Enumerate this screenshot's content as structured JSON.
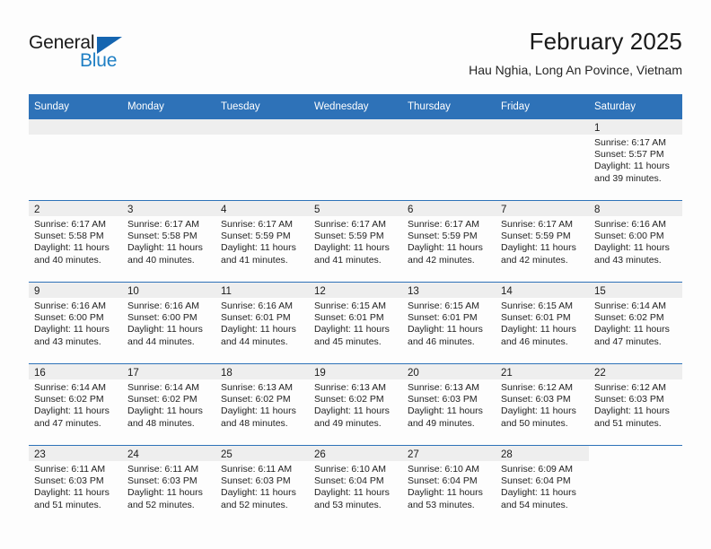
{
  "brand": {
    "name_part1": "General",
    "name_part2": "Blue"
  },
  "header": {
    "title": "February 2025",
    "location": "Hau Nghia, Long An Povince, Vietnam"
  },
  "colors": {
    "header_blue": "#2e72b8",
    "logo_blue": "#1f7fc4",
    "daynum_band": "#eeeeee",
    "page_bg": "#fdfdfd"
  },
  "weekdays": [
    "Sunday",
    "Monday",
    "Tuesday",
    "Wednesday",
    "Thursday",
    "Friday",
    "Saturday"
  ],
  "weeks": [
    [
      {
        "type": "empty"
      },
      {
        "type": "empty"
      },
      {
        "type": "empty"
      },
      {
        "type": "empty"
      },
      {
        "type": "empty"
      },
      {
        "type": "empty"
      },
      {
        "type": "day",
        "num": "1",
        "sunrise": "Sunrise: 6:17 AM",
        "sunset": "Sunset: 5:57 PM",
        "daylight1": "Daylight: 11 hours",
        "daylight2": "and 39 minutes."
      }
    ],
    [
      {
        "type": "day",
        "num": "2",
        "sunrise": "Sunrise: 6:17 AM",
        "sunset": "Sunset: 5:58 PM",
        "daylight1": "Daylight: 11 hours",
        "daylight2": "and 40 minutes."
      },
      {
        "type": "day",
        "num": "3",
        "sunrise": "Sunrise: 6:17 AM",
        "sunset": "Sunset: 5:58 PM",
        "daylight1": "Daylight: 11 hours",
        "daylight2": "and 40 minutes."
      },
      {
        "type": "day",
        "num": "4",
        "sunrise": "Sunrise: 6:17 AM",
        "sunset": "Sunset: 5:59 PM",
        "daylight1": "Daylight: 11 hours",
        "daylight2": "and 41 minutes."
      },
      {
        "type": "day",
        "num": "5",
        "sunrise": "Sunrise: 6:17 AM",
        "sunset": "Sunset: 5:59 PM",
        "daylight1": "Daylight: 11 hours",
        "daylight2": "and 41 minutes."
      },
      {
        "type": "day",
        "num": "6",
        "sunrise": "Sunrise: 6:17 AM",
        "sunset": "Sunset: 5:59 PM",
        "daylight1": "Daylight: 11 hours",
        "daylight2": "and 42 minutes."
      },
      {
        "type": "day",
        "num": "7",
        "sunrise": "Sunrise: 6:17 AM",
        "sunset": "Sunset: 5:59 PM",
        "daylight1": "Daylight: 11 hours",
        "daylight2": "and 42 minutes."
      },
      {
        "type": "day",
        "num": "8",
        "sunrise": "Sunrise: 6:16 AM",
        "sunset": "Sunset: 6:00 PM",
        "daylight1": "Daylight: 11 hours",
        "daylight2": "and 43 minutes."
      }
    ],
    [
      {
        "type": "day",
        "num": "9",
        "sunrise": "Sunrise: 6:16 AM",
        "sunset": "Sunset: 6:00 PM",
        "daylight1": "Daylight: 11 hours",
        "daylight2": "and 43 minutes."
      },
      {
        "type": "day",
        "num": "10",
        "sunrise": "Sunrise: 6:16 AM",
        "sunset": "Sunset: 6:00 PM",
        "daylight1": "Daylight: 11 hours",
        "daylight2": "and 44 minutes."
      },
      {
        "type": "day",
        "num": "11",
        "sunrise": "Sunrise: 6:16 AM",
        "sunset": "Sunset: 6:01 PM",
        "daylight1": "Daylight: 11 hours",
        "daylight2": "and 44 minutes."
      },
      {
        "type": "day",
        "num": "12",
        "sunrise": "Sunrise: 6:15 AM",
        "sunset": "Sunset: 6:01 PM",
        "daylight1": "Daylight: 11 hours",
        "daylight2": "and 45 minutes."
      },
      {
        "type": "day",
        "num": "13",
        "sunrise": "Sunrise: 6:15 AM",
        "sunset": "Sunset: 6:01 PM",
        "daylight1": "Daylight: 11 hours",
        "daylight2": "and 46 minutes."
      },
      {
        "type": "day",
        "num": "14",
        "sunrise": "Sunrise: 6:15 AM",
        "sunset": "Sunset: 6:01 PM",
        "daylight1": "Daylight: 11 hours",
        "daylight2": "and 46 minutes."
      },
      {
        "type": "day",
        "num": "15",
        "sunrise": "Sunrise: 6:14 AM",
        "sunset": "Sunset: 6:02 PM",
        "daylight1": "Daylight: 11 hours",
        "daylight2": "and 47 minutes."
      }
    ],
    [
      {
        "type": "day",
        "num": "16",
        "sunrise": "Sunrise: 6:14 AM",
        "sunset": "Sunset: 6:02 PM",
        "daylight1": "Daylight: 11 hours",
        "daylight2": "and 47 minutes."
      },
      {
        "type": "day",
        "num": "17",
        "sunrise": "Sunrise: 6:14 AM",
        "sunset": "Sunset: 6:02 PM",
        "daylight1": "Daylight: 11 hours",
        "daylight2": "and 48 minutes."
      },
      {
        "type": "day",
        "num": "18",
        "sunrise": "Sunrise: 6:13 AM",
        "sunset": "Sunset: 6:02 PM",
        "daylight1": "Daylight: 11 hours",
        "daylight2": "and 48 minutes."
      },
      {
        "type": "day",
        "num": "19",
        "sunrise": "Sunrise: 6:13 AM",
        "sunset": "Sunset: 6:02 PM",
        "daylight1": "Daylight: 11 hours",
        "daylight2": "and 49 minutes."
      },
      {
        "type": "day",
        "num": "20",
        "sunrise": "Sunrise: 6:13 AM",
        "sunset": "Sunset: 6:03 PM",
        "daylight1": "Daylight: 11 hours",
        "daylight2": "and 49 minutes."
      },
      {
        "type": "day",
        "num": "21",
        "sunrise": "Sunrise: 6:12 AM",
        "sunset": "Sunset: 6:03 PM",
        "daylight1": "Daylight: 11 hours",
        "daylight2": "and 50 minutes."
      },
      {
        "type": "day",
        "num": "22",
        "sunrise": "Sunrise: 6:12 AM",
        "sunset": "Sunset: 6:03 PM",
        "daylight1": "Daylight: 11 hours",
        "daylight2": "and 51 minutes."
      }
    ],
    [
      {
        "type": "day",
        "num": "23",
        "sunrise": "Sunrise: 6:11 AM",
        "sunset": "Sunset: 6:03 PM",
        "daylight1": "Daylight: 11 hours",
        "daylight2": "and 51 minutes."
      },
      {
        "type": "day",
        "num": "24",
        "sunrise": "Sunrise: 6:11 AM",
        "sunset": "Sunset: 6:03 PM",
        "daylight1": "Daylight: 11 hours",
        "daylight2": "and 52 minutes."
      },
      {
        "type": "day",
        "num": "25",
        "sunrise": "Sunrise: 6:11 AM",
        "sunset": "Sunset: 6:03 PM",
        "daylight1": "Daylight: 11 hours",
        "daylight2": "and 52 minutes."
      },
      {
        "type": "day",
        "num": "26",
        "sunrise": "Sunrise: 6:10 AM",
        "sunset": "Sunset: 6:04 PM",
        "daylight1": "Daylight: 11 hours",
        "daylight2": "and 53 minutes."
      },
      {
        "type": "day",
        "num": "27",
        "sunrise": "Sunrise: 6:10 AM",
        "sunset": "Sunset: 6:04 PM",
        "daylight1": "Daylight: 11 hours",
        "daylight2": "and 53 minutes."
      },
      {
        "type": "day",
        "num": "28",
        "sunrise": "Sunrise: 6:09 AM",
        "sunset": "Sunset: 6:04 PM",
        "daylight1": "Daylight: 11 hours",
        "daylight2": "and 54 minutes."
      },
      {
        "type": "blank"
      }
    ]
  ]
}
